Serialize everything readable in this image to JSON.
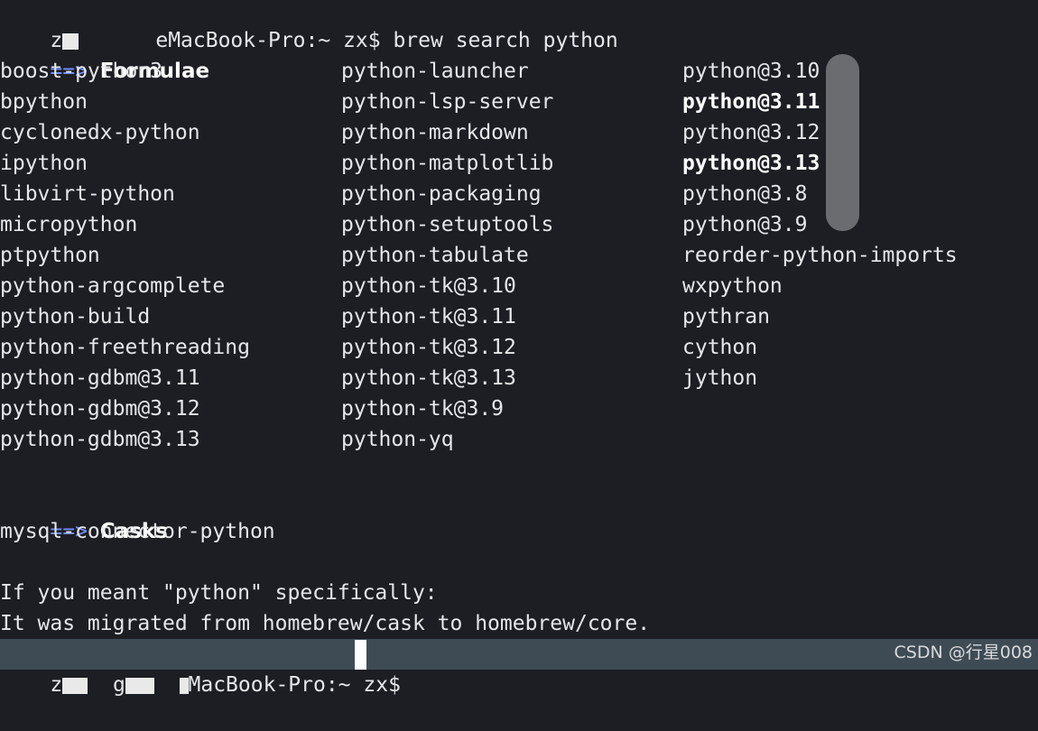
{
  "prompt": {
    "host_prefix": "z",
    "host_suffix": "eMacBook-Pro:~ zx$",
    "command": "brew search python"
  },
  "sections": {
    "formulae": {
      "arrow": "==>",
      "title": "Formulae"
    },
    "casks": {
      "arrow": "==>",
      "title": "Casks"
    }
  },
  "formulae": {
    "col1": [
      "boost-python3",
      "bpython",
      "cyclonedx-python",
      "ipython",
      "libvirt-python",
      "micropython",
      "ptpython",
      "python-argcomplete",
      "python-build",
      "python-freethreading",
      "python-gdbm@3.11",
      "python-gdbm@3.12",
      "python-gdbm@3.13"
    ],
    "col2": [
      "python-launcher",
      "python-lsp-server",
      "python-markdown",
      "python-matplotlib",
      "python-packaging",
      "python-setuptools",
      "python-tabulate",
      "python-tk@3.10",
      "python-tk@3.11",
      "python-tk@3.12",
      "python-tk@3.13",
      "python-tk@3.9",
      "python-yq"
    ],
    "col3": [
      {
        "name": "python@3.10",
        "bold": false
      },
      {
        "name": "python@3.11",
        "bold": true
      },
      {
        "name": "python@3.12",
        "bold": false
      },
      {
        "name": "python@3.13",
        "bold": true
      },
      {
        "name": "python@3.8",
        "bold": false
      },
      {
        "name": "python@3.9",
        "bold": false
      },
      {
        "name": "reorder-python-imports",
        "bold": false
      },
      {
        "name": "wxpython",
        "bold": false
      },
      {
        "name": "pythran",
        "bold": false
      },
      {
        "name": "cython",
        "bold": false
      },
      {
        "name": "jython",
        "bold": false
      }
    ]
  },
  "casks": [
    "mysql-connector-python"
  ],
  "message": {
    "line1": "If you meant \"python\" specifically:",
    "line2": "It was migrated from homebrew/cask to homebrew/core."
  },
  "bottom_prompt": {
    "host_prefix": "z",
    "host_middle": "g",
    "host_suffix": "MacBook-Pro:~ zx$"
  },
  "watermark": "CSDN @行星008",
  "colors": {
    "background": "#1c1e24",
    "arrow": "#6f8fff",
    "bottom_bar": "#3e4b55"
  }
}
